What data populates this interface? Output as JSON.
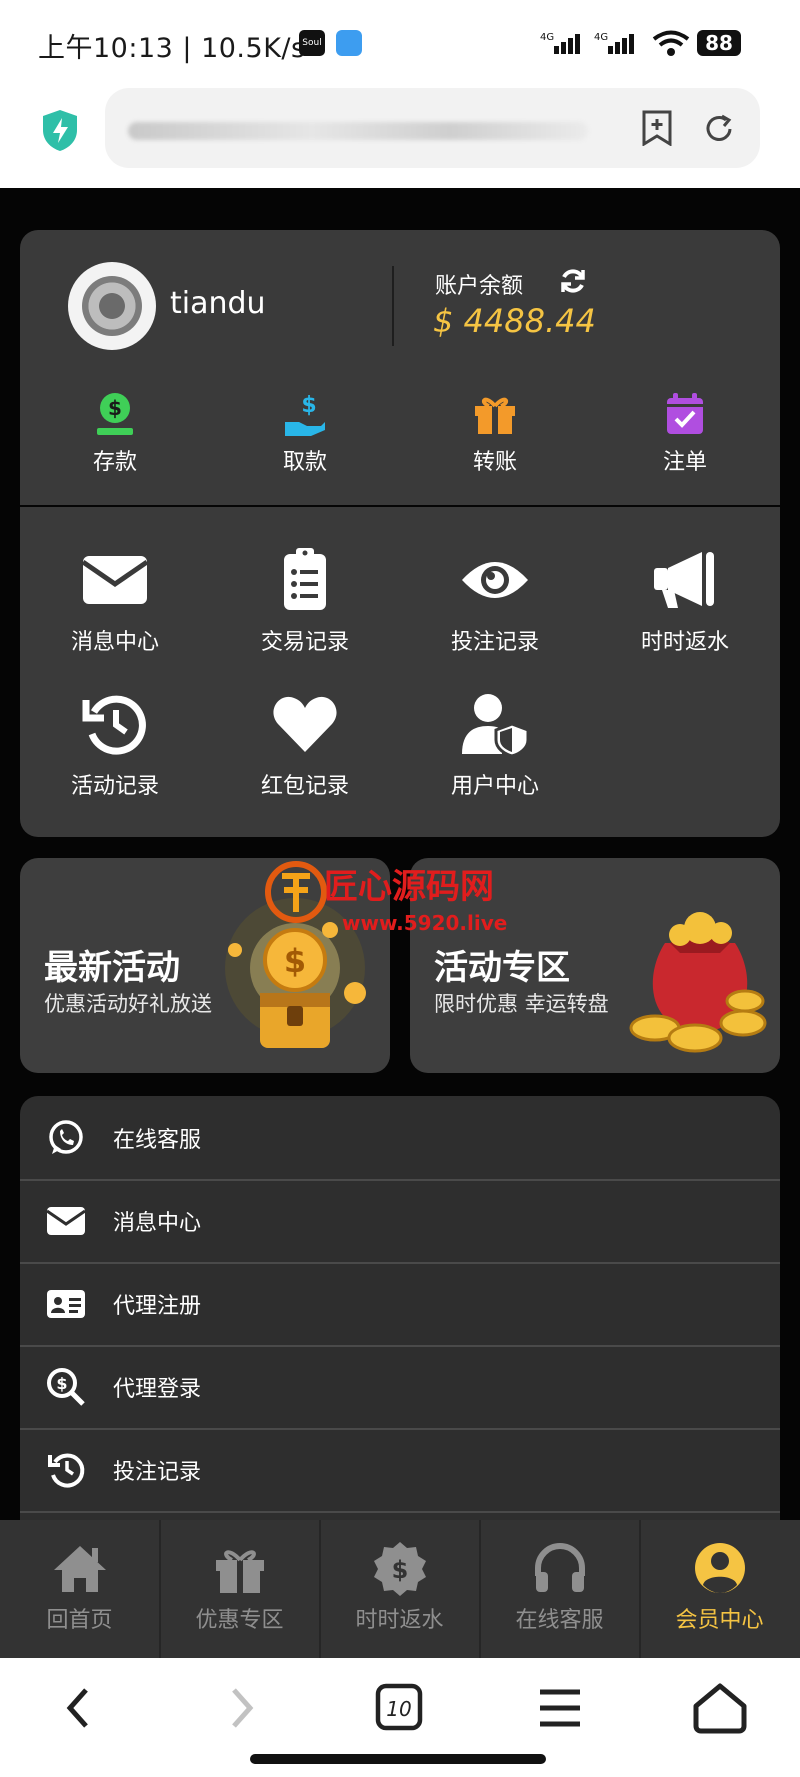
{
  "status_bar": {
    "time": "上午10:13 | 10.5K/s",
    "app_badge": "Soul",
    "net1": "4G",
    "net2": "4G",
    "battery": "88"
  },
  "account": {
    "username": "tiandu",
    "balance_label": "账户余额",
    "balance": "$ 4488.44",
    "actions": [
      {
        "label": "存款",
        "icon": "deposit-icon",
        "color": "#3fcf57"
      },
      {
        "label": "取款",
        "icon": "withdraw-icon",
        "color": "#29b6e8"
      },
      {
        "label": "转账",
        "icon": "gift-icon",
        "color": "#f39a2a"
      },
      {
        "label": "注单",
        "icon": "calendar-check-icon",
        "color": "#b04ee0"
      }
    ]
  },
  "grid": [
    {
      "label": "消息中心",
      "icon": "envelope-icon"
    },
    {
      "label": "交易记录",
      "icon": "clipboard-list-icon"
    },
    {
      "label": "投注记录",
      "icon": "eye-icon"
    },
    {
      "label": "时时返水",
      "icon": "megaphone-icon"
    },
    {
      "label": "活动记录",
      "icon": "history-icon"
    },
    {
      "label": "红包记录",
      "icon": "heart-icon"
    },
    {
      "label": "用户中心",
      "icon": "user-shield-icon"
    }
  ],
  "promos": [
    {
      "title": "最新活动",
      "subtitle": "优惠活动好礼放送"
    },
    {
      "title": "活动专区",
      "subtitle": "限时优惠 幸运转盘"
    }
  ],
  "watermark": {
    "text": "匠心源码网",
    "url": "www.5920.live"
  },
  "list": [
    {
      "label": "在线客服",
      "icon": "whatsapp-icon"
    },
    {
      "label": "消息中心",
      "icon": "envelope-icon"
    },
    {
      "label": "代理注册",
      "icon": "id-card-icon"
    },
    {
      "label": "代理登录",
      "icon": "search-dollar-icon"
    },
    {
      "label": "投注记录",
      "icon": "history-icon"
    }
  ],
  "tabs": [
    {
      "label": "回首页",
      "icon": "home-icon",
      "active": false
    },
    {
      "label": "优惠专区",
      "icon": "gift-icon",
      "active": false
    },
    {
      "label": "时时返水",
      "icon": "dollar-badge-icon",
      "active": false
    },
    {
      "label": "在线客服",
      "icon": "headphones-icon",
      "active": false
    },
    {
      "label": "会员中心",
      "icon": "user-circle-icon",
      "active": true
    }
  ],
  "browser_nav": {
    "tab_count": "10"
  }
}
